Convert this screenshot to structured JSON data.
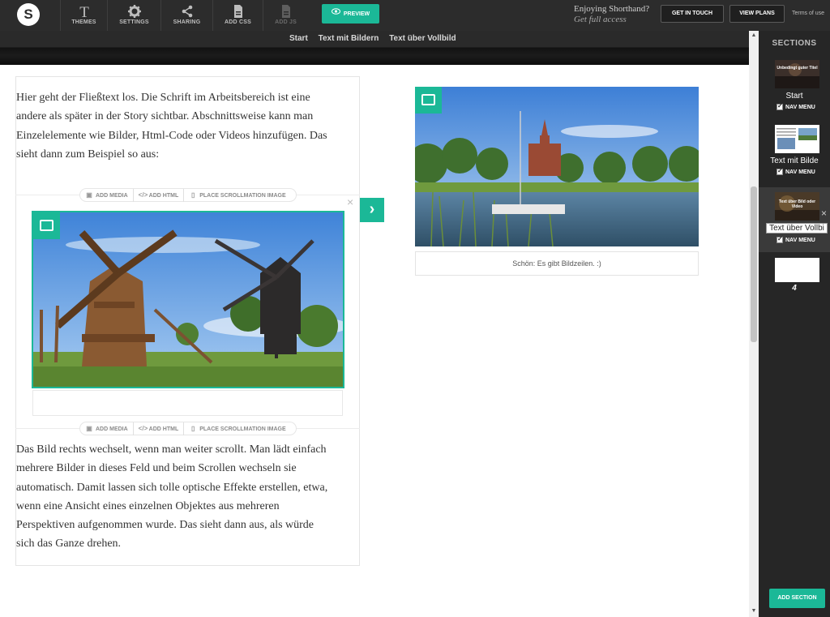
{
  "app": {
    "logo_letter": "S"
  },
  "toolbar": {
    "tools": [
      {
        "label": "THEMES",
        "icon": "themes-icon"
      },
      {
        "label": "SETTINGS",
        "icon": "gear-icon"
      },
      {
        "label": "SHARING",
        "icon": "share-icon"
      },
      {
        "label": "ADD CSS",
        "icon": "css-file-icon"
      },
      {
        "label": "ADD JS",
        "icon": "js-file-icon"
      }
    ],
    "preview_label": "PREVIEW",
    "enjoying": "Enjoying Shorthand?",
    "get_full_access": "Get full access",
    "get_in_touch": "GET IN TOUCH",
    "view_plans": "VIEW PLANS",
    "terms": "Terms of use"
  },
  "tabs": [
    "Start",
    "Text mit Bildern",
    "Text über Vollbild"
  ],
  "editor": {
    "para1": "Hier geht der Fließtext los. Die Schrift im Arbeitsbereich ist eine andere als später in der Story sichtbar. Abschnittsweise kann man Einzelelemente wie Bilder, Html-Code oder Videos hinzufügen. Das sieht dann zum Beispiel so aus:",
    "para2": "Das Bild rechts wechselt, wenn man weiter scrollt. Man lädt einfach mehrere Bilder in dieses Feld und beim Scrollen wechseln sie automatisch. Damit lassen sich tolle optische Effekte erstellen, etwa, wenn eine Ansicht eines einzelnen Objektes aus mehreren Perspektiven aufgenommen wurde. Das sieht dann aus, als würde sich das Ganze drehen.",
    "media_bar": {
      "add_media": "ADD MEDIA",
      "add_html": "ADD HTML",
      "place_scrollmation": "PLACE SCROLLMATION IMAGE"
    },
    "close_glyph": "×",
    "next_glyph": "›",
    "caption": "Schön: Es gibt Bildzeilen. :)"
  },
  "sections_panel": {
    "title": "SECTIONS",
    "sections": [
      {
        "name": "Start",
        "nav_menu": "NAV MENU",
        "thumb_text": "Unbedingt guter Titel"
      },
      {
        "name": "Text mit Bilde",
        "nav_menu": "NAV MENU"
      },
      {
        "name": "Text über Vollbi",
        "nav_menu": "NAV MENU",
        "thumb_text": "Text über Bild oder Video",
        "close": "×"
      },
      {
        "name": "4"
      }
    ],
    "add_section": "ADD SECTION"
  },
  "colors": {
    "accent": "#1bb897",
    "toolbar_bg": "#2c2c2c",
    "panel_bg": "#262626"
  }
}
